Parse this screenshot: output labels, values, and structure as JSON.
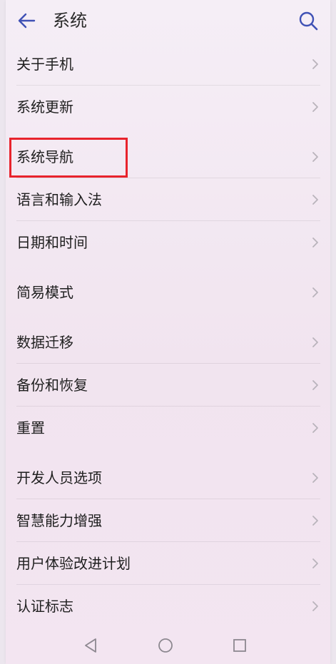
{
  "header": {
    "title": "系统",
    "back_icon": "arrow-left-icon",
    "search_icon": "search-icon"
  },
  "colors": {
    "accent": "#3f51b5",
    "highlight": "#e8232c",
    "background": "#f3e8f2"
  },
  "menu": {
    "items": [
      {
        "label": "关于手机"
      },
      {
        "label": "系统更新"
      },
      {
        "label": "系统导航"
      },
      {
        "label": "语言和输入法"
      },
      {
        "label": "日期和时间"
      },
      {
        "label": "简易模式"
      },
      {
        "label": "数据迁移"
      },
      {
        "label": "备份和恢复"
      },
      {
        "label": "重置"
      },
      {
        "label": "开发人员选项"
      },
      {
        "label": "智慧能力增强"
      },
      {
        "label": "用户体验改进计划"
      },
      {
        "label": "认证标志"
      }
    ]
  },
  "navbar": {
    "icons": [
      "triangle-back-icon",
      "circle-home-icon",
      "square-recent-icon"
    ]
  }
}
